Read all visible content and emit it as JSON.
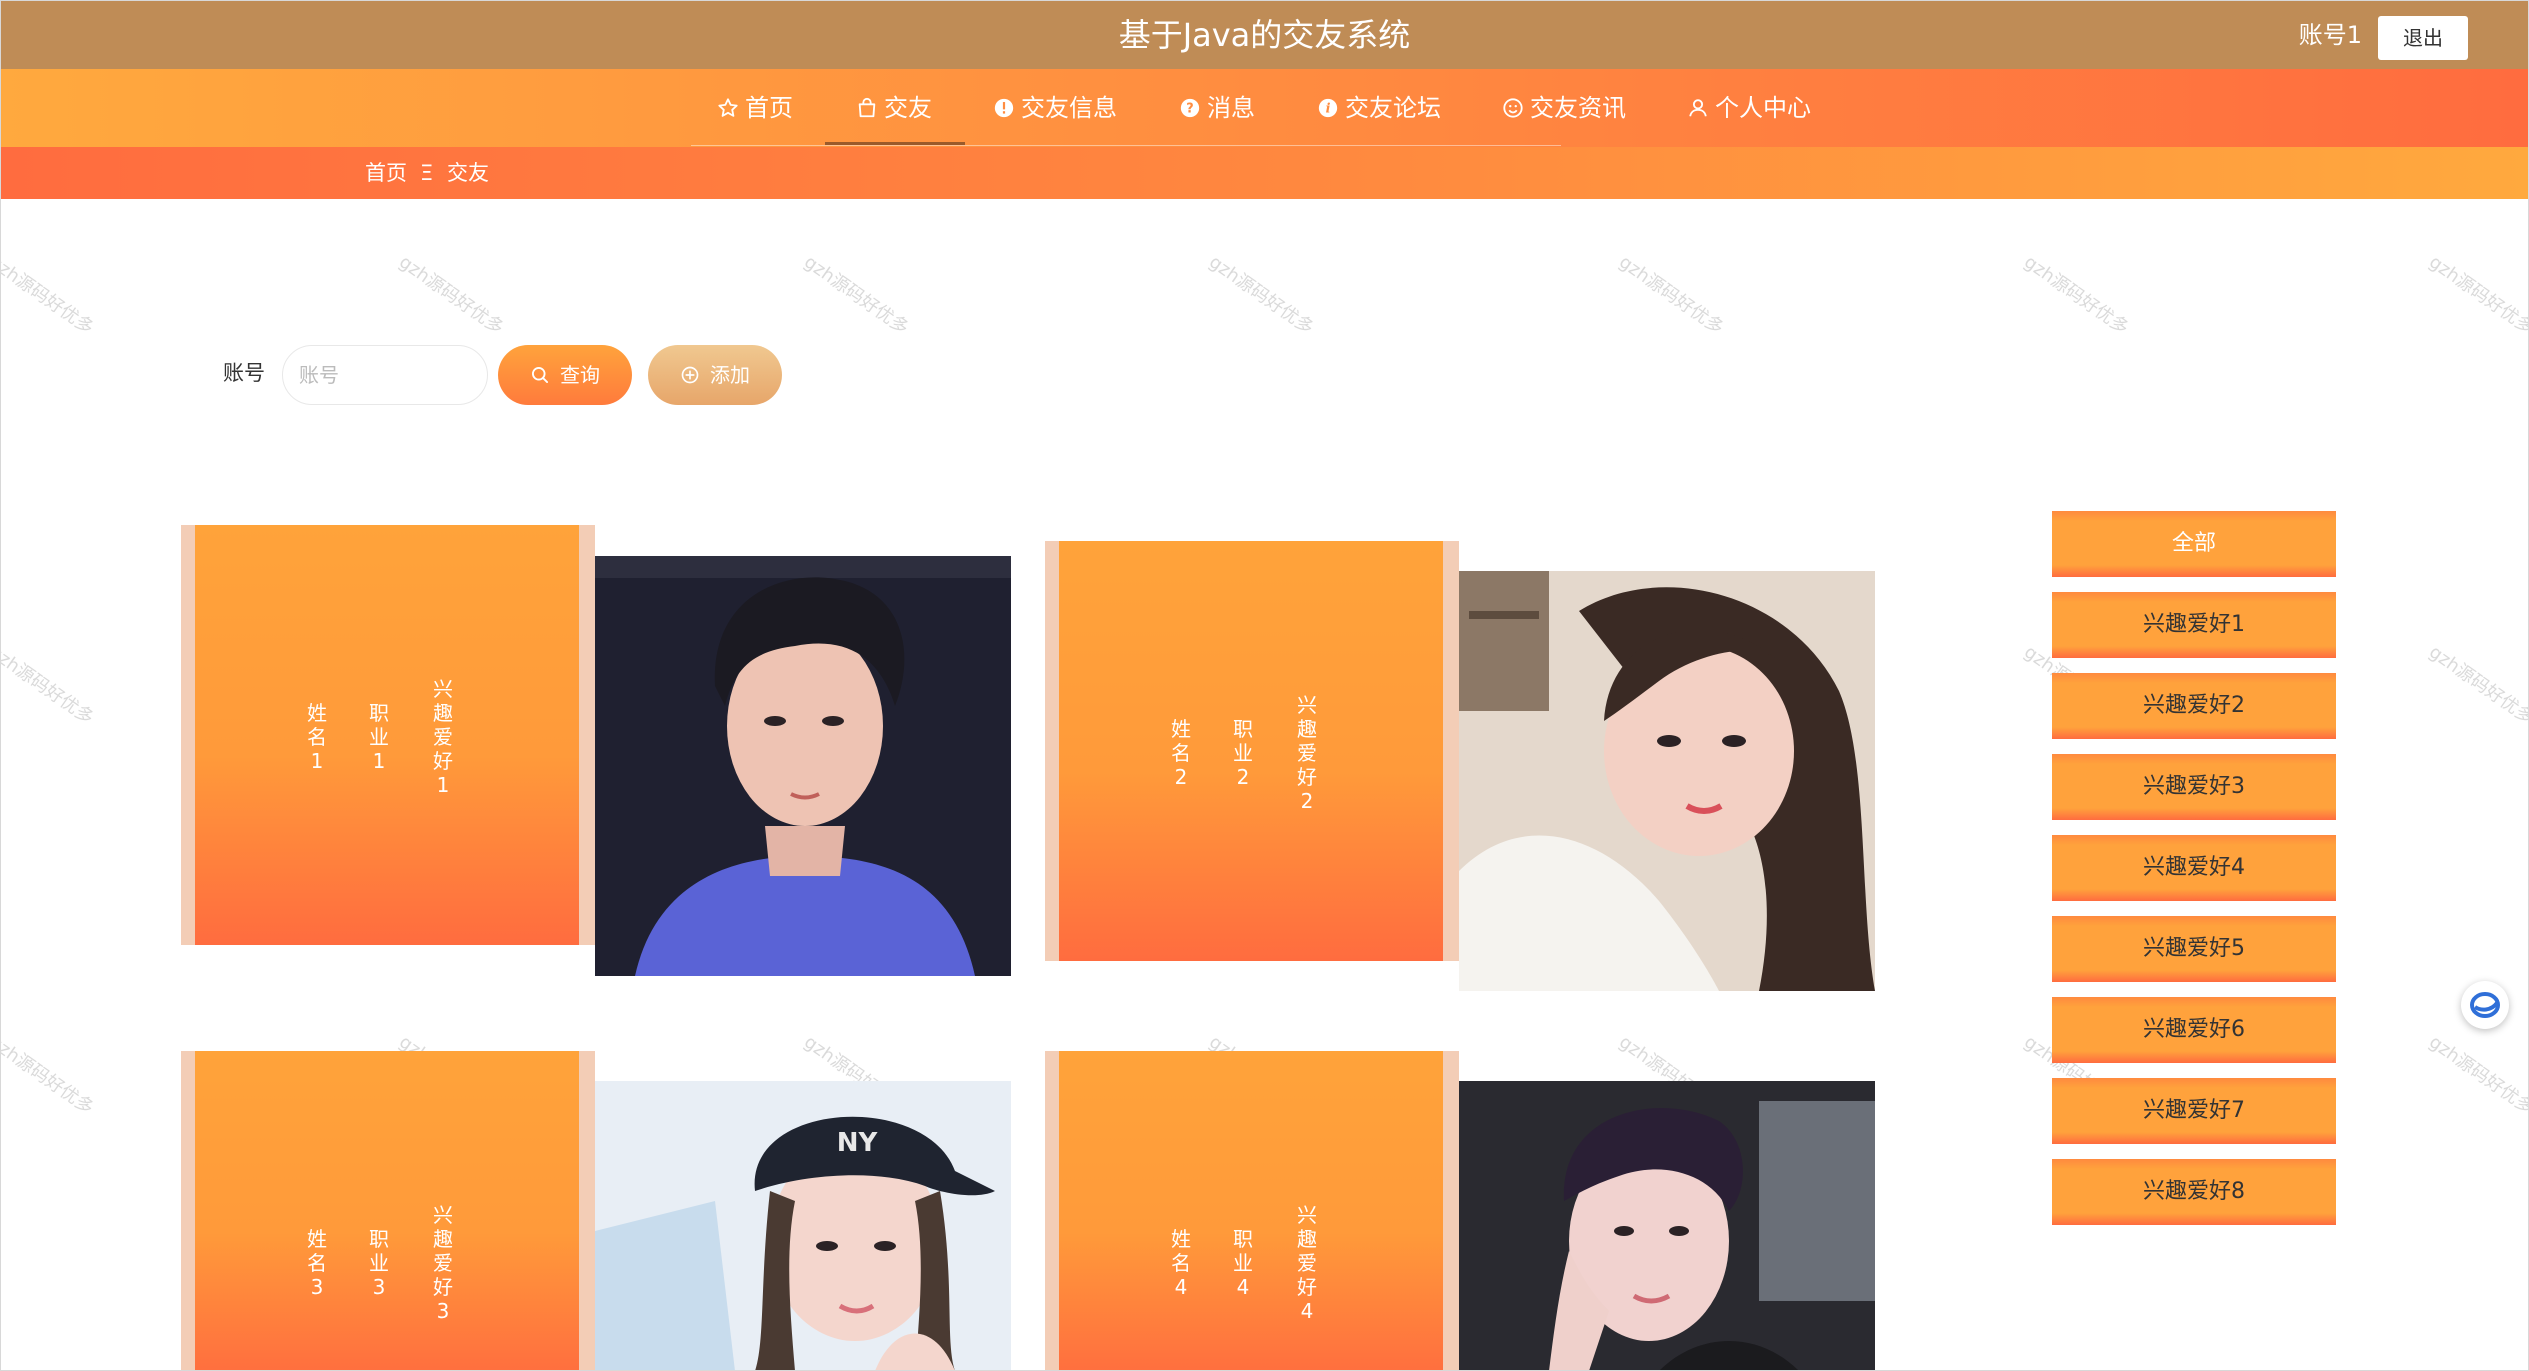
{
  "header": {
    "title": "基于Java的交友系统",
    "account": "账号1",
    "logout_label": "退出"
  },
  "nav": {
    "items": [
      {
        "label": "首页",
        "icon": "star-icon"
      },
      {
        "label": "交友",
        "icon": "bag-icon"
      },
      {
        "label": "交友信息",
        "icon": "info-circle-icon"
      },
      {
        "label": "消息",
        "icon": "question-circle-icon"
      },
      {
        "label": "交友论坛",
        "icon": "info-icon"
      },
      {
        "label": "交友资讯",
        "icon": "smile-icon"
      },
      {
        "label": "个人中心",
        "icon": "user-icon"
      }
    ],
    "active": "交友"
  },
  "breadcrumb": {
    "home": "首页",
    "separator": "Ξ",
    "current": "交友"
  },
  "search": {
    "label": "账号",
    "placeholder": "账号",
    "query_label": "查询",
    "add_label": "添加"
  },
  "cards": [
    {
      "name": "姓名1",
      "job": "职业1",
      "hobby": "兴趣爱好1"
    },
    {
      "name": "姓名2",
      "job": "职业2",
      "hobby": "兴趣爱好2"
    },
    {
      "name": "姓名3",
      "job": "职业3",
      "hobby": "兴趣爱好3"
    },
    {
      "name": "姓名4",
      "job": "职业4",
      "hobby": "兴趣爱好4"
    }
  ],
  "categories": [
    "全部",
    "兴趣爱好1",
    "兴趣爱好2",
    "兴趣爱好3",
    "兴趣爱好4",
    "兴趣爱好5",
    "兴趣爱好6",
    "兴趣爱好7",
    "兴趣爱好8"
  ],
  "watermark": "gzh源码好优多",
  "colors": {
    "header": "#bf8c56",
    "accent": "#ff8c40",
    "accent_dark": "#ff6c3f",
    "add_button": "#e7a66a"
  }
}
